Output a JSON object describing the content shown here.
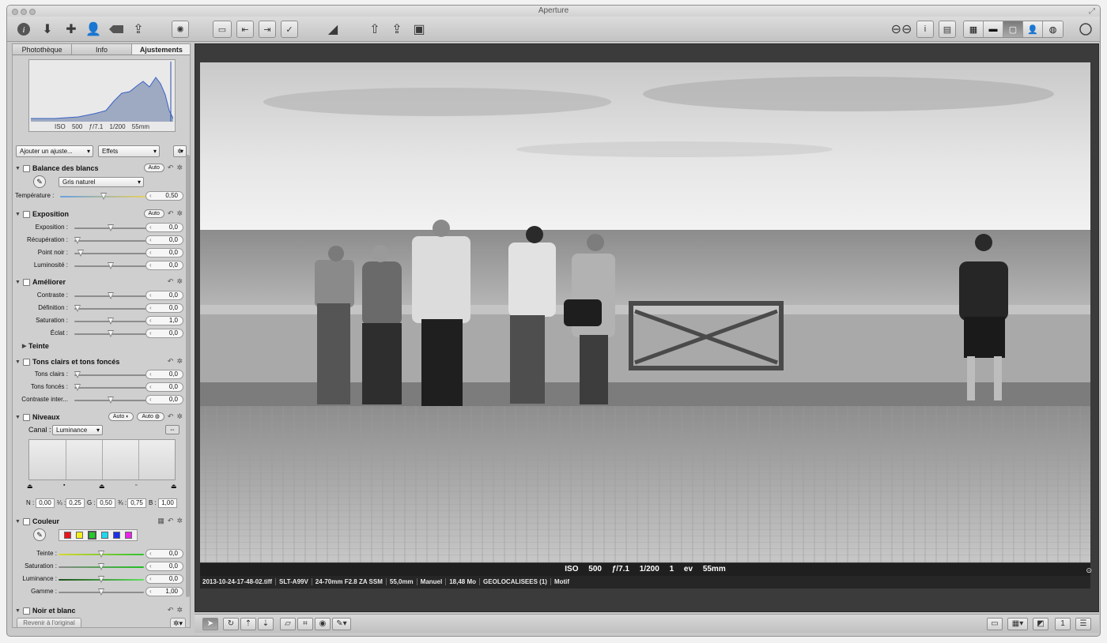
{
  "window": {
    "title": "Aperture"
  },
  "tabs": [
    {
      "label": "Photothèque"
    },
    {
      "label": "Info"
    },
    {
      "label": "Ajustements"
    }
  ],
  "histogram": {
    "meta": "ISO 500 ƒ/7.1 1/200 55mm"
  },
  "controls": {
    "add_adjustment": "Ajouter un ajuste...",
    "effects": "Effets"
  },
  "white_balance": {
    "title": "Balance des blancs",
    "auto": "Auto",
    "mode": "Gris naturel",
    "temp_label": "Température :",
    "temp_value": "0,50",
    "temp_level": 0.5
  },
  "exposure": {
    "title": "Exposition",
    "auto": "Auto",
    "rows": [
      {
        "label": "Exposition :",
        "value": "0,0",
        "level": 0.5
      },
      {
        "label": "Récupération :",
        "value": "0,0",
        "level": 0.0
      },
      {
        "label": "Point noir :",
        "value": "0,0",
        "level": 0.05
      },
      {
        "label": "Luminosité :",
        "value": "0,0",
        "level": 0.5
      }
    ]
  },
  "enhance": {
    "title": "Améliorer",
    "rows": [
      {
        "label": "Contraste :",
        "value": "0,0",
        "level": 0.5
      },
      {
        "label": "Définition :",
        "value": "0,0",
        "level": 0.0
      },
      {
        "label": "Saturation :",
        "value": "1,0",
        "level": 0.5
      },
      {
        "label": "Éclat :",
        "value": "0,0",
        "level": 0.5
      }
    ],
    "tint": "Teinte"
  },
  "highlights_shadows": {
    "title": "Tons clairs et tons foncés",
    "rows": [
      {
        "label": "Tons clairs :",
        "value": "0,0",
        "level": 0.0
      },
      {
        "label": "Tons foncés :",
        "value": "0,0",
        "level": 0.0
      },
      {
        "label": "Contraste inter...",
        "value": "0,0",
        "level": 0.5
      }
    ]
  },
  "levels": {
    "title": "Niveaux",
    "auto1": "Auto",
    "auto2": "Auto",
    "channel_label": "Canal :",
    "channel": "Luminance",
    "fields": [
      {
        "label": "N :",
        "value": "0,00"
      },
      {
        "label": "¼ :",
        "value": "0,25"
      },
      {
        "label": "G :",
        "value": "0,50"
      },
      {
        "label": "¾ :",
        "value": "0,75"
      },
      {
        "label": "B :",
        "value": "1,00"
      }
    ]
  },
  "color": {
    "title": "Couleur",
    "swatches": [
      "#e8141c",
      "#f4ee1c",
      "#20cc28",
      "#20d8ee",
      "#1e2ee8",
      "#e824e8"
    ],
    "rows": [
      {
        "label": "Teinte :",
        "value": "0,0",
        "level": 0.5
      },
      {
        "label": "Saturation :",
        "value": "0,0",
        "level": 0.5
      },
      {
        "label": "Luminance :",
        "value": "0,0",
        "level": 0.5
      },
      {
        "label": "Gamme :",
        "value": "1,00",
        "level": 0.5
      }
    ]
  },
  "bw": {
    "title": "Noir et blanc"
  },
  "revert": "Revenir à l'original",
  "viewer": {
    "meta_line": "ISO 500 ƒ/7.1 1/200 1 ev 55mm",
    "info": [
      "2013-10-24-17-48-02.tiff",
      "SLT-A99V",
      "24-70mm F2.8 ZA SSM",
      "55,0mm",
      "Manuel",
      "18,48 Mo",
      "GEOLOCALISEES (1)",
      "Motif"
    ]
  }
}
